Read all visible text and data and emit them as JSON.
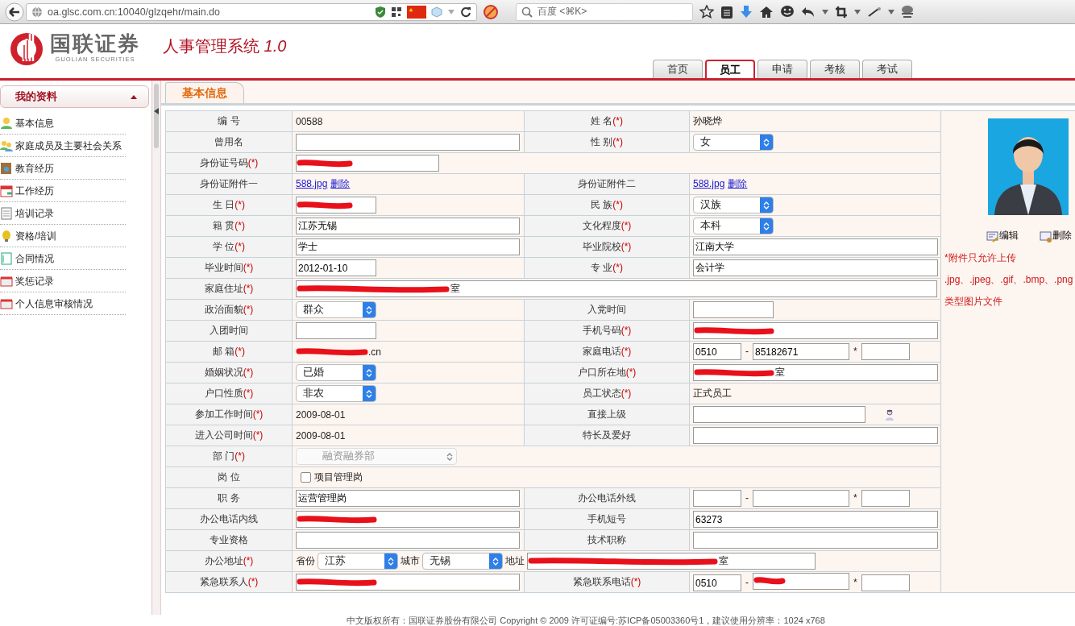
{
  "browser": {
    "url": "oa.glsc.com.cn:10040/glzqehr/main.do",
    "search_placeholder": "百度 <⌘K>"
  },
  "header": {
    "logo_name": "国联证券",
    "logo_subtitle": "GUOLIAN SECURITIES",
    "system_title": "人事管理系统 *1.0*"
  },
  "nav_tabs": [
    {
      "label": "首页",
      "selected": false
    },
    {
      "label": "员工",
      "selected": true
    },
    {
      "label": "申请",
      "selected": false
    },
    {
      "label": "考核",
      "selected": false
    },
    {
      "label": "考试",
      "selected": false
    }
  ],
  "sidebar": {
    "title": "我的资料",
    "expanded": true,
    "items": [
      {
        "label": "基本信息"
      },
      {
        "label": "家庭成员及主要社会关系"
      },
      {
        "label": "教育经历"
      },
      {
        "label": "工作经历"
      },
      {
        "label": "培训记录"
      },
      {
        "label": "资格/培训"
      },
      {
        "label": "合同情况"
      },
      {
        "label": "奖惩记录"
      },
      {
        "label": "个人信息审核情况"
      }
    ]
  },
  "section_tab": "基本信息",
  "form_rows": [
    {
      "cells": [
        {
          "kind": "label",
          "text": "编  号"
        },
        {
          "kind": "text",
          "value": "00588"
        },
        {
          "kind": "label",
          "text": "姓  名",
          "mark": "(*)"
        },
        {
          "kind": "text",
          "value": "孙晓烨"
        }
      ]
    },
    {
      "cells": [
        {
          "kind": "label",
          "text": "曾用名"
        },
        {
          "kind": "input"
        },
        {
          "kind": "label",
          "text": "性  别",
          "mark": "(*)"
        },
        {
          "kind": "select",
          "value": "女",
          "disabled": false
        }
      ]
    },
    {
      "cells": [
        {
          "kind": "label",
          "text": "身份证号码",
          "mark": "(*)"
        },
        {
          "kind": "input",
          "short": true,
          "wide": true,
          "redacted": true
        }
      ]
    },
    {
      "cells": [
        {
          "kind": "label",
          "text": "身份证附件一"
        },
        {
          "kind": "links",
          "links": [
            "588.jpg",
            "删除"
          ]
        },
        {
          "kind": "label",
          "text": "身份证附件二"
        },
        {
          "kind": "links",
          "links": [
            "588.jpg",
            "删除"
          ]
        }
      ]
    },
    {
      "cells": [
        {
          "kind": "label",
          "text": "生  日",
          "mark": "(*)"
        },
        {
          "kind": "input",
          "short": true,
          "redacted": true
        },
        {
          "kind": "label",
          "text": "民  族",
          "mark": "(*)"
        },
        {
          "kind": "select",
          "value": "汉族",
          "disabled": false
        }
      ]
    },
    {
      "cells": [
        {
          "kind": "label",
          "text": "籍  贯",
          "mark": "(*)"
        },
        {
          "kind": "input",
          "value": "江苏无锡"
        },
        {
          "kind": "label",
          "text": "文化程度",
          "mark": "(*)"
        },
        {
          "kind": "select",
          "value": "本科",
          "disabled": false
        }
      ]
    },
    {
      "cells": [
        {
          "kind": "label",
          "text": "学  位",
          "mark": "(*)"
        },
        {
          "kind": "input",
          "value": "学士"
        },
        {
          "kind": "label",
          "text": "毕业院校",
          "mark": "(*)"
        },
        {
          "kind": "input",
          "value": "江南大学"
        }
      ]
    },
    {
      "cells": [
        {
          "kind": "label",
          "text": "毕业时间",
          "mark": "(*)"
        },
        {
          "kind": "input",
          "value": "2012-01-10",
          "short": true
        },
        {
          "kind": "label",
          "text": "专  业",
          "mark": "(*)"
        },
        {
          "kind": "input",
          "value": "会计学"
        }
      ]
    },
    {
      "cells": [
        {
          "kind": "label",
          "text": "家庭住址",
          "mark": "(*)"
        },
        {
          "kind": "input",
          "value": "室",
          "wide": true,
          "redacted": true
        }
      ]
    },
    {
      "cells": [
        {
          "kind": "label",
          "text": "政治面貌",
          "mark": "(*)"
        },
        {
          "kind": "select",
          "value": "群众",
          "disabled": false
        },
        {
          "kind": "label",
          "text": "入党时间"
        },
        {
          "kind": "input",
          "short": true
        }
      ]
    },
    {
      "cells": [
        {
          "kind": "label",
          "text": "入团时间"
        },
        {
          "kind": "input",
          "short": true
        },
        {
          "kind": "label",
          "text": "手机号码",
          "mark": "(*)"
        },
        {
          "kind": "input",
          "redacted": true
        }
      ]
    },
    {
      "cells": [
        {
          "kind": "label",
          "text": "邮  箱",
          "mark": "(*)"
        },
        {
          "kind": "text",
          "value": ".cn",
          "redacted": true
        },
        {
          "kind": "label",
          "text": "家庭电话",
          "mark": "(*)"
        },
        {
          "kind": "phone",
          "area_code": "0510",
          "number": "85182671",
          "separators": [
            "-",
            "*"
          ]
        }
      ]
    },
    {
      "cells": [
        {
          "kind": "label",
          "text": "婚姻状况",
          "mark": "(*)"
        },
        {
          "kind": "select",
          "value": "已婚",
          "disabled": false
        },
        {
          "kind": "label",
          "text": "户口所在地",
          "mark": "(*)"
        },
        {
          "kind": "input",
          "value": "室",
          "redacted": true
        }
      ]
    },
    {
      "cells": [
        {
          "kind": "label",
          "text": "户口性质",
          "mark": "(*)"
        },
        {
          "kind": "select",
          "value": "非农",
          "disabled": false
        },
        {
          "kind": "label",
          "text": "员工状态",
          "mark": "(*)"
        },
        {
          "kind": "text",
          "value": "正式员工"
        }
      ]
    },
    {
      "cells": [
        {
          "kind": "label",
          "text": "参加工作时间",
          "mark": "(*)"
        },
        {
          "kind": "text",
          "value": "2009-08-01"
        },
        {
          "kind": "label",
          "text": "直接上级"
        },
        {
          "kind": "input",
          "picker": true
        }
      ]
    },
    {
      "cells": [
        {
          "kind": "label",
          "text": "进入公司时间",
          "mark": "(*)"
        },
        {
          "kind": "text",
          "value": "2009-08-01"
        },
        {
          "kind": "label",
          "text": "特长及爱好"
        },
        {
          "kind": "input"
        }
      ]
    },
    {
      "cells": [
        {
          "kind": "label",
          "text": "部  门",
          "mark": "(*)"
        },
        {
          "kind": "select",
          "value": "融资融券部",
          "disabled": true,
          "wide": true
        }
      ]
    },
    {
      "cells": [
        {
          "kind": "label",
          "text": "岗  位"
        },
        {
          "kind": "checkbox",
          "label": "项目管理岗",
          "checked": false,
          "wide": true
        }
      ]
    },
    {
      "cells": [
        {
          "kind": "label",
          "text": "职  务"
        },
        {
          "kind": "input",
          "value": "运营管理岗"
        },
        {
          "kind": "label",
          "text": "办公电话外线"
        },
        {
          "kind": "phone",
          "separators": [
            "-",
            "*"
          ]
        }
      ]
    },
    {
      "cells": [
        {
          "kind": "label",
          "text": "办公电话内线"
        },
        {
          "kind": "input",
          "redacted": true
        },
        {
          "kind": "label",
          "text": "手机短号"
        },
        {
          "kind": "input",
          "value": "63273"
        }
      ]
    },
    {
      "cells": [
        {
          "kind": "label",
          "text": "专业资格"
        },
        {
          "kind": "input"
        },
        {
          "kind": "label",
          "text": "技术职称"
        },
        {
          "kind": "input"
        }
      ]
    },
    {
      "cells": [
        {
          "kind": "label",
          "text": "办公地址",
          "mark": "(*)"
        },
        {
          "kind": "address",
          "wide": true,
          "parts": [
            {
              "caption": "省份",
              "select": "江苏"
            },
            {
              "caption": "城市",
              "select": "无锡"
            },
            {
              "caption": "地址",
              "value": "室",
              "redacted": true
            }
          ]
        }
      ]
    },
    {
      "cells": [
        {
          "kind": "label",
          "text": "紧急联系人",
          "mark": "(*)"
        },
        {
          "kind": "input",
          "redacted": true
        },
        {
          "kind": "label",
          "text": "紧急联系电话",
          "mark": "(*)"
        },
        {
          "kind": "phone",
          "area_code": "0510",
          "separators": [
            "-",
            "*"
          ],
          "redacted": true
        }
      ]
    }
  ],
  "photo_panel": {
    "actions": [
      "编辑",
      "删除"
    ],
    "notes": [
      "*附件只允许上传",
      ".jpg、.jpeg、.gif、.bmp、.png",
      "类型图片文件"
    ]
  },
  "footer": "中文版权所有：国联证券股份有限公司 Copyright © 2009 许可证编号:苏ICP备05003360号1，建议使用分辨率：1024 x768"
}
